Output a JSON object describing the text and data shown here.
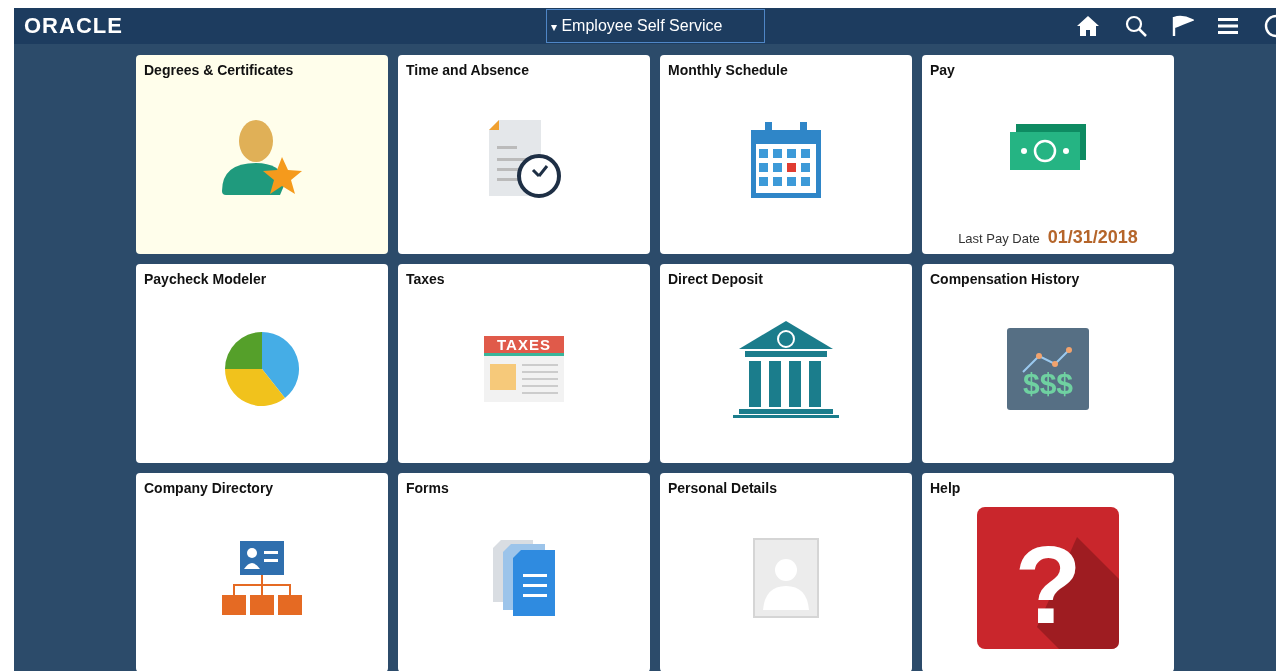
{
  "header": {
    "logo": "ORACLE",
    "title_caret": "▾",
    "title": "Employee Self Service"
  },
  "tiles": [
    {
      "title": "Degrees & Certificates",
      "selected": true
    },
    {
      "title": "Time and Absence",
      "selected": false
    },
    {
      "title": "Monthly Schedule",
      "selected": false
    },
    {
      "title": "Pay",
      "selected": false,
      "footer_label": "Last Pay Date",
      "footer_value": "01/31/2018"
    },
    {
      "title": "Paycheck Modeler",
      "selected": false
    },
    {
      "title": "Taxes",
      "selected": false,
      "icon_text": "TAXES"
    },
    {
      "title": "Direct Deposit",
      "selected": false
    },
    {
      "title": "Compensation History",
      "selected": false,
      "icon_text": "$$$"
    },
    {
      "title": "Company Directory",
      "selected": false
    },
    {
      "title": "Forms",
      "selected": false
    },
    {
      "title": "Personal Details",
      "selected": false
    },
    {
      "title": "Help",
      "selected": false,
      "icon_text": "?"
    }
  ]
}
